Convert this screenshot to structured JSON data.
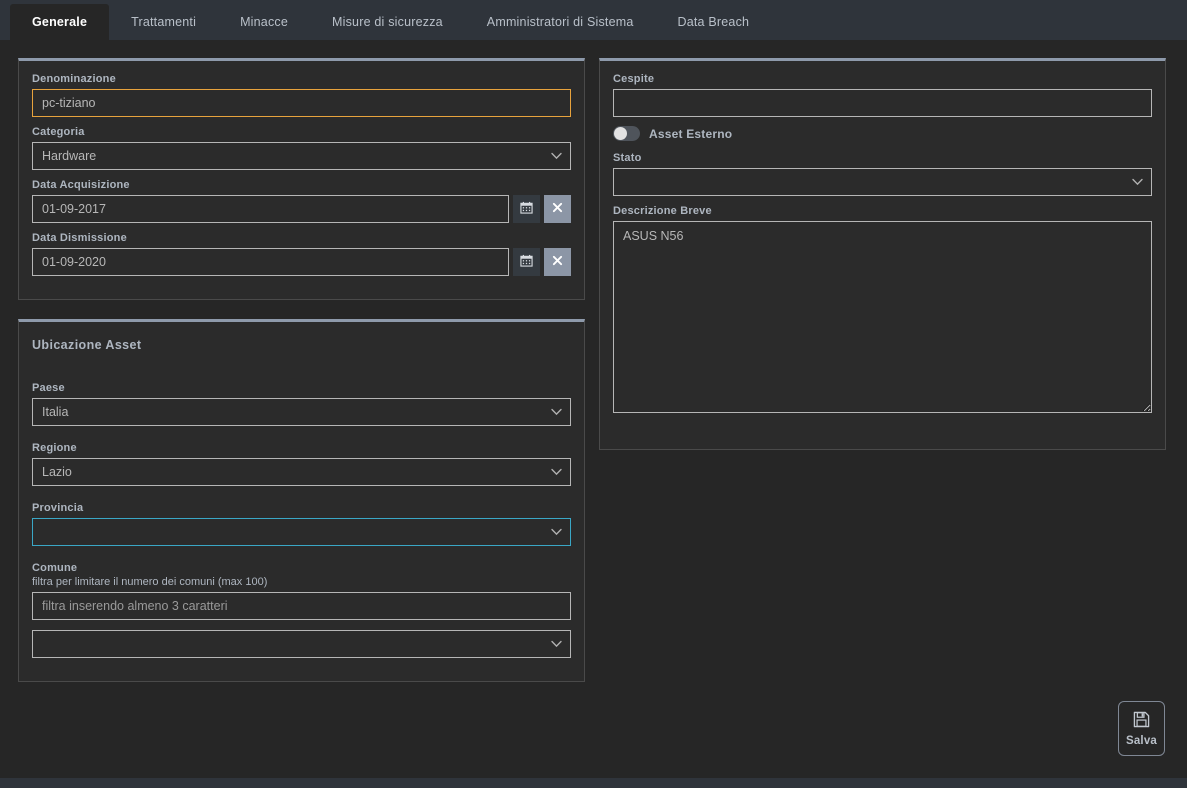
{
  "tabs": [
    {
      "label": "Generale",
      "active": true
    },
    {
      "label": "Trattamenti",
      "active": false
    },
    {
      "label": "Minacce",
      "active": false
    },
    {
      "label": "Misure di sicurezza",
      "active": false
    },
    {
      "label": "Amministratori di Sistema",
      "active": false
    },
    {
      "label": "Data Breach",
      "active": false
    }
  ],
  "left": {
    "card_general": {
      "denominazione": {
        "label": "Denominazione",
        "value": "pc-tiziano",
        "placeholder": "",
        "border_color": "#e8a33d"
      },
      "categoria": {
        "label": "Categoria",
        "value": "Hardware",
        "options": [
          "Hardware"
        ]
      },
      "data_acquisizione": {
        "label": "Data Acquisizione",
        "value": "01-09-2017",
        "calendar_icon": "calendar-icon",
        "clear_icon": "close-icon"
      },
      "data_dismissione": {
        "label": "Data Dismissione",
        "value": "01-09-2020",
        "calendar_icon": "calendar-icon",
        "clear_icon": "close-icon"
      }
    },
    "card_location": {
      "title": "Ubicazione Asset",
      "paese": {
        "label": "Paese",
        "value": "Italia",
        "options": [
          "Italia"
        ]
      },
      "regione": {
        "label": "Regione",
        "value": "Lazio",
        "options": [
          "Lazio"
        ]
      },
      "provincia": {
        "label": "Provincia",
        "value": "",
        "options": [],
        "border_color": "#3aa7c6"
      },
      "comune": {
        "label": "Comune",
        "helper": "filtra per limitare il numero dei comuni (max 100)",
        "filter_value": "",
        "filter_placeholder": "filtra inserendo almeno 3 caratteri",
        "select_value": "",
        "options": []
      }
    }
  },
  "right": {
    "card_details": {
      "cespite": {
        "label": "Cespite",
        "value": "",
        "placeholder": ""
      },
      "asset_esterno": {
        "label": "Asset Esterno",
        "checked": false
      },
      "stato": {
        "label": "Stato",
        "value": "",
        "options": []
      },
      "descrizione_breve": {
        "label": "Descrizione Breve",
        "value": "ASUS N56",
        "placeholder": ""
      }
    }
  },
  "actions": {
    "save": {
      "label": "Salva",
      "icon": "save-floppy-icon"
    }
  },
  "colors": {
    "page_background": "#262626",
    "tabbar_background": "#2f343b",
    "card_background": "#2b2b2b",
    "card_top_border": "#8e9aab",
    "label_text": "#aeb6c0",
    "input_border": "#b6b6b6",
    "warn_border": "#e8a33d",
    "focus_border": "#3aa7c6",
    "clear_button": "#8c96a6"
  }
}
